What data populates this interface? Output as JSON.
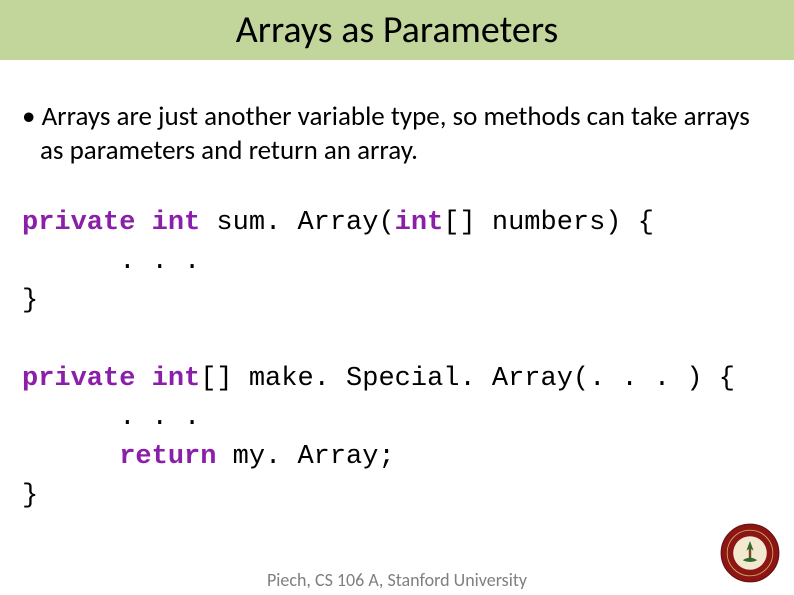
{
  "title": "Arrays as Parameters",
  "bullet": "Arrays are just another variable type, so methods can take arrays as parameters and return an array.",
  "code1": {
    "kw_private": "private",
    "kw_int": "int",
    "fn": " sum. Array(",
    "kw_int2": "int",
    "rest1": "[] numbers) {",
    "dots": "      . . .",
    "close": "}"
  },
  "code2": {
    "kw_private": "private",
    "kw_int": "int",
    "rest1": "[] make. Special. Array(. . . ) {",
    "dots": "      . . .",
    "kw_return": "return",
    "rest2": " my. Array;",
    "close": "}"
  },
  "footer": "Piech, CS 106 A, Stanford University"
}
